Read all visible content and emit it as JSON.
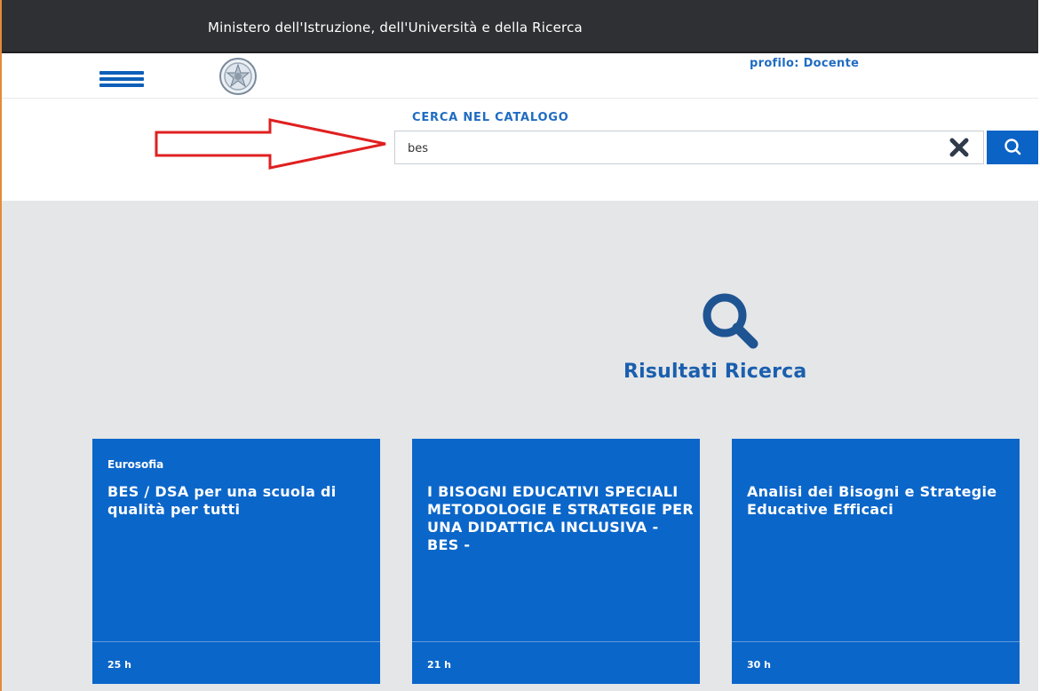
{
  "topbar": {
    "ministry": "Ministero dell'Istruzione, dell'Università e della Ricerca"
  },
  "header": {
    "profile": "profilo: Docente",
    "menu_icon": "hamburger-menu-icon",
    "logo_icon": "emblem-icon"
  },
  "search": {
    "title": "CERCA NEL CATALOGO",
    "value": "bes",
    "clear_icon": "close-icon",
    "search_icon": "search-icon"
  },
  "annotation": {
    "arrow_icon": "arrow-right-icon",
    "arrow_color": "#e02020"
  },
  "results": {
    "icon": "search-icon",
    "title": "Risultati Ricerca",
    "cards": [
      {
        "provider": "Eurosofia",
        "title": "BES / DSA per una scuola di qualità per tutti",
        "hours": "25 h"
      },
      {
        "provider": "",
        "title": "I BISOGNI EDUCATIVI SPECIALI METODOLOGIE E STRATEGIE PER UNA DIDATTICA INCLUSIVA - BES -",
        "hours": "21 h"
      },
      {
        "provider": "",
        "title": "Analisi dei Bisogni e Strategie Educative Efficaci",
        "hours": "30 h"
      }
    ]
  },
  "colors": {
    "primary": "#0b66c9",
    "topbar": "#2e3033",
    "background": "#e5e6e8",
    "accent": "#1f6cc2"
  }
}
